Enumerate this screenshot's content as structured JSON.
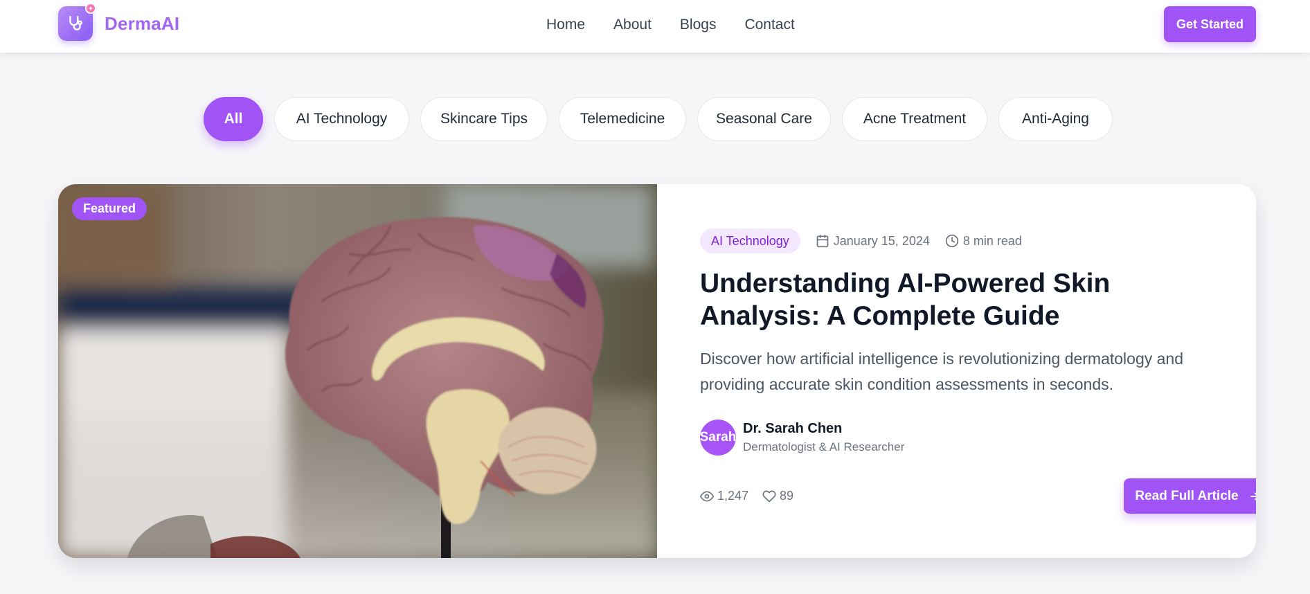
{
  "brand": {
    "name": "DermaAI",
    "logo_icon": "stethoscope-icon",
    "accent_color": "#a054f5"
  },
  "nav": {
    "items": [
      {
        "label": "Home"
      },
      {
        "label": "About"
      },
      {
        "label": "Blogs"
      },
      {
        "label": "Contact"
      }
    ],
    "cta_label": "Get Started"
  },
  "filters": {
    "active": "All",
    "items": [
      {
        "label": "All"
      },
      {
        "label": "AI Technology"
      },
      {
        "label": "Skincare Tips"
      },
      {
        "label": "Telemedicine"
      },
      {
        "label": "Seasonal Care"
      },
      {
        "label": "Acne Treatment"
      },
      {
        "label": "Anti-Aging"
      }
    ]
  },
  "featured_post": {
    "badge": "Featured",
    "category": "AI Technology",
    "date": "January 15, 2024",
    "read_time": "8 min read",
    "title": "Understanding AI-Powered Skin Analysis: A Complete Guide",
    "excerpt": "Discover how artificial intelligence is revolutionizing dermatology and providing accurate skin condition assessments in seconds.",
    "author": {
      "avatar_text": "Sarah",
      "name": "Dr. Sarah Chen",
      "role": "Dermatologist & AI Researcher"
    },
    "views": "1,247",
    "likes": "89",
    "read_label": "Read Full Article"
  }
}
